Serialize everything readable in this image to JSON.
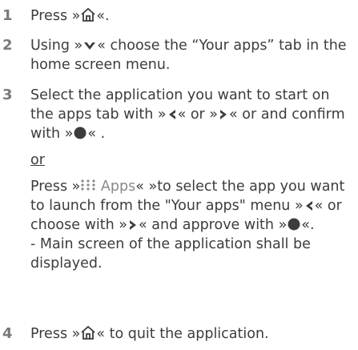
{
  "steps": [
    {
      "number": "1",
      "pre": "Press »",
      "icon": "home-icon",
      "post": "«."
    },
    {
      "number": "2",
      "pre": "Using »",
      "icon": "down-arrow-icon",
      "post": "« choose the “Your apps” tab in the home screen menu."
    },
    {
      "number": "3",
      "p1_a": "Select the application you want to start on the apps tab with »",
      "p1_b": "« or »",
      "p1_c": "« or and confirm with »",
      "p1_d": "« .",
      "or": "or",
      "p2_a": "Press »",
      "apps_label": "Apps",
      "p2_b": "« »to select the app you want to launch from the \"Your apps\" menu »",
      "p2_c": "« or choose with »",
      "p2_d": "« and approve with »",
      "p2_e": "«.",
      "p3": "- Main screen of the application shall be displayed."
    },
    {
      "number": "4",
      "pre": "Press »",
      "icon": "home-icon",
      "post": "« to quit the application."
    }
  ],
  "colors": {
    "text": "#3c3c3c",
    "number": "#7a7a7a",
    "apps": "#8a8a8a"
  }
}
